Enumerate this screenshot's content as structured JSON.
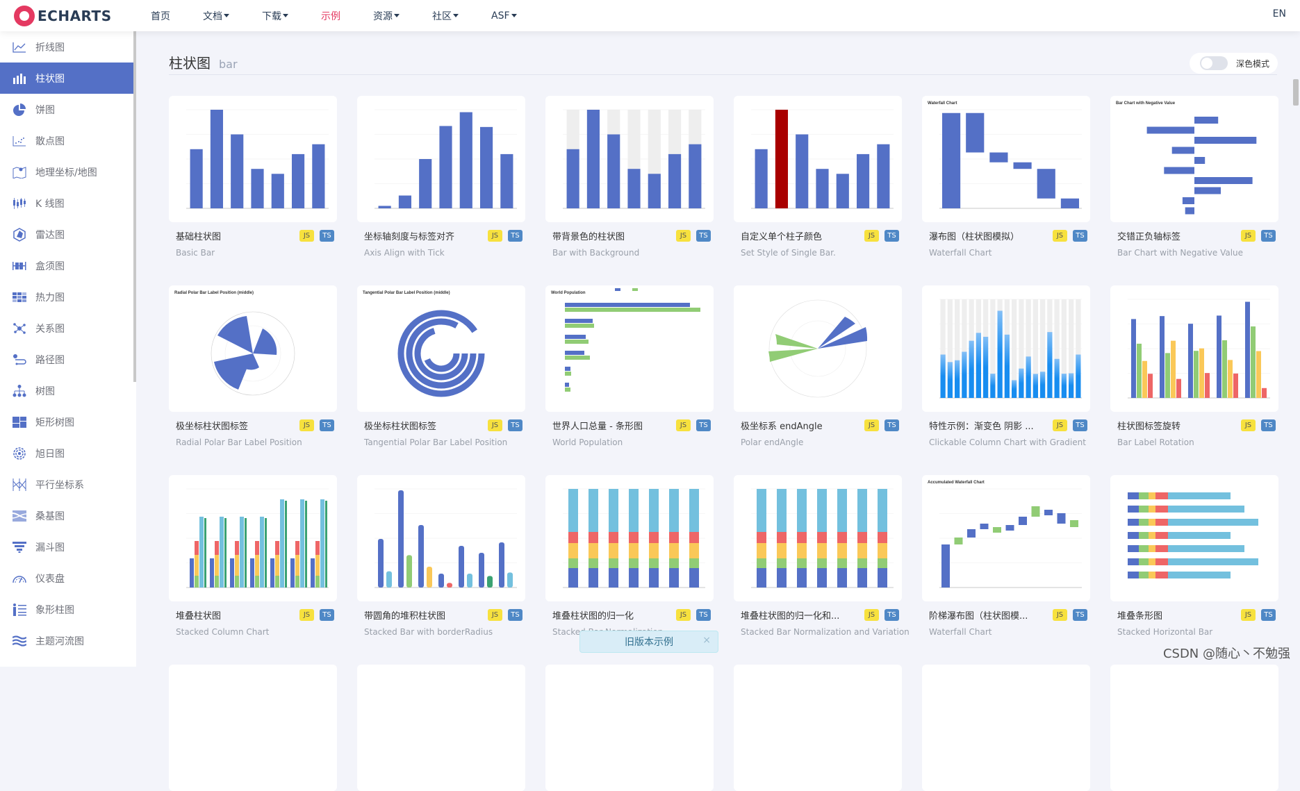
{
  "header": {
    "logo_text": "ECHARTS",
    "nav": [
      {
        "label": "首页",
        "dropdown": false,
        "active": false
      },
      {
        "label": "文档",
        "dropdown": true,
        "active": false
      },
      {
        "label": "下载",
        "dropdown": true,
        "active": false
      },
      {
        "label": "示例",
        "dropdown": false,
        "active": true
      },
      {
        "label": "资源",
        "dropdown": true,
        "active": false
      },
      {
        "label": "社区",
        "dropdown": true,
        "active": false
      },
      {
        "label": "ASF",
        "dropdown": true,
        "active": false
      }
    ],
    "lang": "EN"
  },
  "sidebar": {
    "items": [
      {
        "label": "折线图",
        "icon": "line-chart-icon"
      },
      {
        "label": "柱状图",
        "icon": "bar-chart-icon",
        "active": true
      },
      {
        "label": "饼图",
        "icon": "pie-chart-icon"
      },
      {
        "label": "散点图",
        "icon": "scatter-icon"
      },
      {
        "label": "地理坐标/地图",
        "icon": "map-icon"
      },
      {
        "label": "K 线图",
        "icon": "candlestick-icon"
      },
      {
        "label": "雷达图",
        "icon": "radar-icon"
      },
      {
        "label": "盒须图",
        "icon": "boxplot-icon"
      },
      {
        "label": "热力图",
        "icon": "heatmap-icon"
      },
      {
        "label": "关系图",
        "icon": "graph-icon"
      },
      {
        "label": "路径图",
        "icon": "lines-icon"
      },
      {
        "label": "树图",
        "icon": "tree-icon"
      },
      {
        "label": "矩形树图",
        "icon": "treemap-icon"
      },
      {
        "label": "旭日图",
        "icon": "sunburst-icon"
      },
      {
        "label": "平行坐标系",
        "icon": "parallel-icon"
      },
      {
        "label": "桑基图",
        "icon": "sankey-icon"
      },
      {
        "label": "漏斗图",
        "icon": "funnel-icon"
      },
      {
        "label": "仪表盘",
        "icon": "gauge-icon"
      },
      {
        "label": "象形柱图",
        "icon": "pictorial-bar-icon"
      },
      {
        "label": "主题河流图",
        "icon": "theme-river-icon"
      }
    ]
  },
  "main": {
    "title_cn": "柱状图",
    "title_en": "bar",
    "dark_mode_label": "深色模式",
    "dark_mode_on": false,
    "badge_js": "JS",
    "badge_ts": "TS",
    "cards": [
      {
        "cn": "基础柱状图",
        "en": "Basic Bar",
        "thumb": "basic"
      },
      {
        "cn": "坐标轴刻度与标签对齐",
        "en": "Axis Align with Tick",
        "thumb": "align"
      },
      {
        "cn": "带背景色的柱状图",
        "en": "Bar with Background",
        "thumb": "background"
      },
      {
        "cn": "自定义单个柱子颜色",
        "en": "Set Style of Single Bar.",
        "thumb": "single"
      },
      {
        "cn": "瀑布图（柱状图模拟）",
        "en": "Waterfall Chart",
        "thumb": "waterfall"
      },
      {
        "cn": "交错正负轴标签",
        "en": "Bar Chart with Negative Value",
        "thumb": "negative"
      },
      {
        "cn": "极坐标柱状图标签",
        "en": "Radial Polar Bar Label Position",
        "thumb": "radial"
      },
      {
        "cn": "极坐标柱状图标签",
        "en": "Tangential Polar Bar Label Position",
        "thumb": "tangential"
      },
      {
        "cn": "世界人口总量 - 条形图",
        "en": "World Population",
        "thumb": "population"
      },
      {
        "cn": "极坐标系 endAngle",
        "en": "Polar endAngle",
        "thumb": "polar"
      },
      {
        "cn": "特性示例：渐变色 阴影 ...",
        "en": "Clickable Column Chart with Gradient",
        "thumb": "gradient"
      },
      {
        "cn": "柱状图标签旋转",
        "en": "Bar Label Rotation",
        "thumb": "rotation"
      },
      {
        "cn": "堆叠柱状图",
        "en": "Stacked Column Chart",
        "thumb": "stacked"
      },
      {
        "cn": "带圆角的堆积柱状图",
        "en": "Stacked Bar with borderRadius",
        "thumb": "rounded"
      },
      {
        "cn": "堆叠柱状图的归一化",
        "en": "Stacked Bar Normalization",
        "thumb": "normal"
      },
      {
        "cn": "堆叠柱状图的归一化和...",
        "en": "Stacked Bar Normalization and Variation",
        "thumb": "normal"
      },
      {
        "cn": "阶梯瀑布图（柱状图模...",
        "en": "Waterfall Chart",
        "thumb": "stepwater"
      },
      {
        "cn": "堆叠条形图",
        "en": "Stacked Horizontal Bar",
        "thumb": "hstack"
      }
    ],
    "thumb_titles": {
      "waterfall": "Waterfall Chart",
      "negative": "Bar Chart with Negative Value",
      "radial": "Radial Polar Bar Label Position (middle)",
      "tangential": "Tangential Polar Bar Label Position (middle)",
      "population": "World Population",
      "stepwater": "Accumulated Waterfall Chart"
    }
  },
  "toast": {
    "label": "旧版本示例",
    "close": "×"
  },
  "watermark": "CSDN @随心丶不勉强",
  "colors": {
    "accent": "#5470c6",
    "active_nav": "#e43961",
    "highlight_bar": "#a90000"
  }
}
